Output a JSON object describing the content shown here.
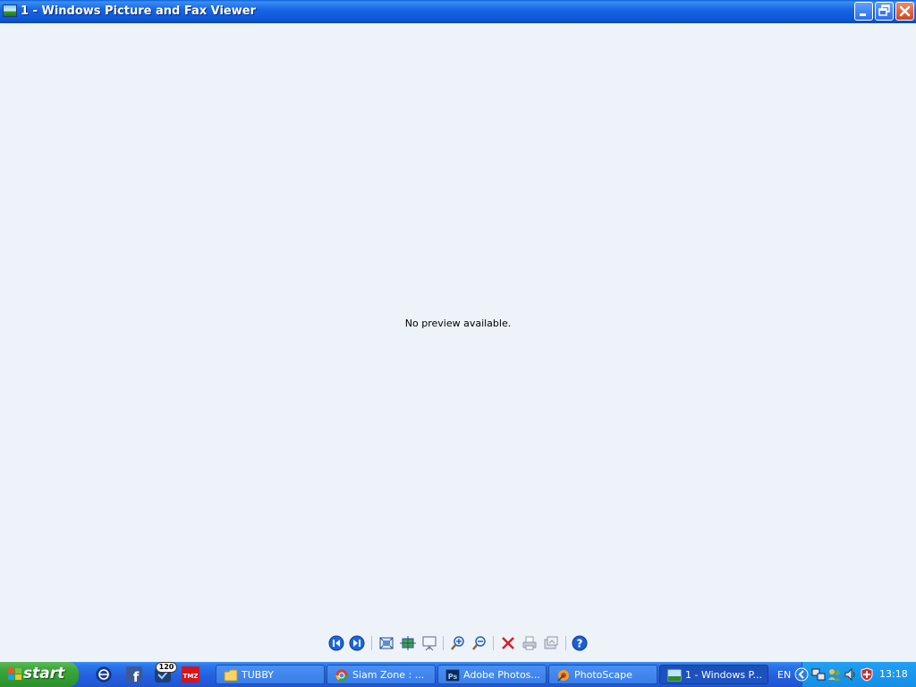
{
  "window": {
    "title": "1 - Windows Picture and Fax Viewer",
    "controls": [
      "minimize",
      "restore",
      "close"
    ]
  },
  "viewer": {
    "message": "No preview available.",
    "toolbar": [
      {
        "name": "previous-image-icon"
      },
      {
        "name": "next-image-icon"
      },
      {
        "name": "best-fit-icon"
      },
      {
        "name": "actual-size-icon"
      },
      {
        "name": "slideshow-icon"
      },
      {
        "name": "zoom-in-icon"
      },
      {
        "name": "zoom-out-icon"
      },
      {
        "name": "delete-icon"
      },
      {
        "name": "print-icon"
      },
      {
        "name": "copy-to-icon"
      },
      {
        "name": "help-icon"
      }
    ]
  },
  "taskbar": {
    "start_label": "start",
    "quick_launch": [
      {
        "name": "browser-icon"
      },
      {
        "name": "facebook-icon"
      },
      {
        "name": "messenger-icon",
        "badge": "120"
      },
      {
        "name": "tmz-icon",
        "text": "TMZ"
      }
    ],
    "tasks": [
      {
        "label": "TUBBY",
        "icon": "folder-icon",
        "active": false
      },
      {
        "label": "Siam Zone : ...",
        "icon": "chrome-icon",
        "active": false
      },
      {
        "label": "Adobe Photos...",
        "icon": "photoshop-icon",
        "icon_text": "Ps",
        "active": false
      },
      {
        "label": "PhotoScape",
        "icon": "photoscape-icon",
        "active": false
      },
      {
        "label": "1 - Windows P...",
        "icon": "picture-viewer-icon",
        "active": true
      }
    ],
    "language": "EN",
    "clock": "13:18"
  },
  "colors": {
    "viewer_bg": "#eef3fa",
    "titlebar": "#0b55d3",
    "taskbar": "#245ede",
    "start": "#3aa93a",
    "tray": "#148ee6"
  }
}
